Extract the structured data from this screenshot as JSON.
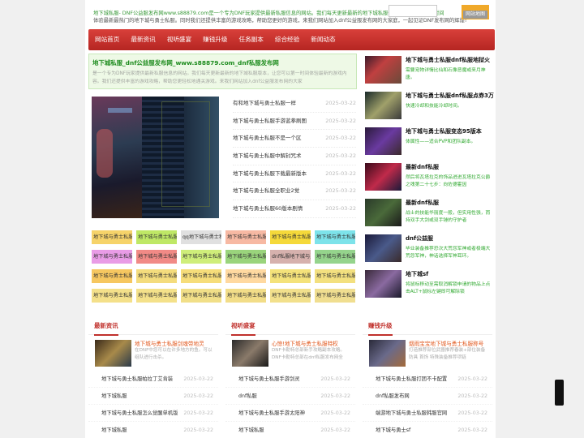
{
  "topbar": {
    "line1": "地下城私服- DNF公益服发布网www.s88879.com是一个专为DNF玩家提供最新私服信息的网站。我们每天更新最新的地下城私服信息，让您可以第一时间",
    "line2": "体验最新最热门的地下城与勇士私服。同时我们还提供丰富的游戏攻略，帮助您更好的游戏，来我们网站加入dnf公益服发布网的大家庭，一起见证DNF发布网的辉煌!",
    "map_button": "网站地图"
  },
  "nav": [
    "网站首页",
    "最新资讯",
    "视听盛宴",
    "赚钱升级",
    "任务副本",
    "综合经验",
    "新闻动态"
  ],
  "intro": {
    "title": "地下城私服_dnf公益服发布网_www.s88879.com_dnf私服发布网",
    "desc": "是一个专为DNF玩家提供最新私服信息的网站。我们每天更新最新的地下城私服版本，让您可以第一时间体验最新的游戏内容。我们还提供丰富的游戏攻略，帮助您更轻松地通关游戏。来我们网站加入dnf公益服发布网的大家"
  },
  "news": [
    {
      "title": "有和地下城与勇士私服一样",
      "date": "2025-03-22"
    },
    {
      "title": "地下城与勇士私服手游蓝拳刷图",
      "date": "2025-03-22"
    },
    {
      "title": "地下城与勇士私服不是一个区",
      "date": "2025-03-22"
    },
    {
      "title": "地下城与勇士私服中解封咒术",
      "date": "2025-03-22"
    },
    {
      "title": "地下城与勇士私服下载最新版本",
      "date": "2025-03-22"
    },
    {
      "title": "地下城与勇士私服全职业2觉",
      "date": "2025-03-22"
    },
    {
      "title": "地下城与勇士私服60版本剧情",
      "date": "2025-03-22"
    }
  ],
  "tags": [
    {
      "label": "地下城与勇士私服",
      "color": "#f6d36a"
    },
    {
      "label": "地下城与勇士私服",
      "color": "#bfe866"
    },
    {
      "label": "qq地下城与勇士私服",
      "color": "#e0e0e0"
    },
    {
      "label": "地下城与勇士私服",
      "color": "#f7b9a3"
    },
    {
      "label": "地下城与勇士私服",
      "color": "#f5d93a"
    },
    {
      "label": "地下城与勇士私服",
      "color": "#7de3ea"
    },
    {
      "label": "地下城与勇士私服",
      "color": "#e99ce6"
    },
    {
      "label": "地下城与勇士私服",
      "color": "#f18a86"
    },
    {
      "label": "地下城与勇士私服",
      "color": "#cfee7a"
    },
    {
      "label": "地下城与勇士私服",
      "color": "#9ad47c"
    },
    {
      "label": "dnf私服地下城与勇士",
      "color": "#d6b1ad"
    },
    {
      "label": "地下城与勇士私服",
      "color": "#95d48c"
    },
    {
      "label": "地下城与勇士私服",
      "color": "#f6c760"
    },
    {
      "label": "地下城与勇士私服",
      "color": "#f4dc7d"
    },
    {
      "label": "地下城与勇士私服",
      "color": "#f6dd7a"
    },
    {
      "label": "地下城与勇士私服",
      "color": "#ffd9a0"
    },
    {
      "label": "地下城与勇士私服",
      "color": "#f4e27a"
    },
    {
      "label": "地下城与勇士私服",
      "color": "#f3e07f"
    },
    {
      "label": "地下城与勇士私服",
      "color": "#f4e08a"
    },
    {
      "label": "地下城与勇士私服",
      "color": "#f4e18a"
    },
    {
      "label": "地下城与勇士私服",
      "color": "#f1df88"
    },
    {
      "label": "地下城与勇士私服",
      "color": "#f2dd88"
    },
    {
      "label": "地下城与勇士私服",
      "color": "#f2e08c"
    },
    {
      "label": "地下城与勇士私服",
      "color": "#f0de90"
    }
  ],
  "right_list": [
    {
      "title": "地下城与勇士私服dnf私服地狱火",
      "sub": "需要宠物详情比仙和石像恶魔或来月神唐。"
    },
    {
      "title": "地下城与勇士私服dnf私服点券3万",
      "sub": "快速冷却和技能冷却时间。"
    },
    {
      "title": "地下城与勇士私服变态95版本",
      "sub": "体属性——适合PVP和团队副本。"
    },
    {
      "title": "最新dnf私服",
      "sub": "然后将瓦塔拉克的饰品进进瓦塔拉克公爵之魂第二十七步：向佐德霍因"
    },
    {
      "title": "最新dnf私服",
      "sub": "战士的技能华丽度一般，但实用性强，而持双手大剑或双手锤的守护者"
    },
    {
      "title": "dnf公益服",
      "sub": "毕业装备推荐恐次大荒怨军神或者极端大荒怨军神，神话选择军神耳环。"
    },
    {
      "title": "地下城sf",
      "sub": "将鼠标移动至需取消解锁申请的物品上点击ALT+鼠标左键即可解除锁"
    }
  ],
  "sections": [
    {
      "head": "最新资讯",
      "feat_title": "地下城与勇士私服剑魂带地灵",
      "feat_sub": "在DNF中您可以在许多地方的鱼。可以组队进行击杀。",
      "rows": [
        {
          "title": "地下城与勇士私服帕拉丁艾肯装",
          "date": "2025-03-22"
        },
        {
          "title": "地下城私服",
          "date": "2025-03-22"
        },
        {
          "title": "地下城与勇士私服怎么觉醒单机版",
          "date": "2025-03-22"
        },
        {
          "title": "地下城私服",
          "date": "2025-03-22"
        }
      ]
    },
    {
      "head": "视听盛宴",
      "feat_title": "心惊!地下城与勇士私服特权",
      "feat_sub": "DNF卡勒特总部新手攻略副本攻略。DNF卡勒特总部在dnf私服发布网全",
      "rows": [
        {
          "title": "地下城与勇士私服手游剑灵",
          "date": "2025-03-22"
        },
        {
          "title": "dnf私服",
          "date": "2025-03-22"
        },
        {
          "title": "地下城与勇士私服手游太阳神",
          "date": "2025-03-22"
        },
        {
          "title": "地下城私服",
          "date": "2025-03-22"
        }
      ]
    },
    {
      "head": "赚钱升级",
      "feat_title": "烟雨宝宝地下城与勇士私服称号",
      "feat_sub": "打造推荐部位武器推荐春装+部位装备 防具 首饰 特殊装备推荐项链",
      "rows": [
        {
          "title": "地下城与勇士私服打团不卡配置",
          "date": "2025-03-22"
        },
        {
          "title": "dnf私服发布网",
          "date": "2025-03-22"
        },
        {
          "title": "端游地下城与勇士私服韩服官网",
          "date": "2025-03-22"
        },
        {
          "title": "地下城与勇士sf",
          "date": "2025-03-22"
        }
      ]
    }
  ]
}
